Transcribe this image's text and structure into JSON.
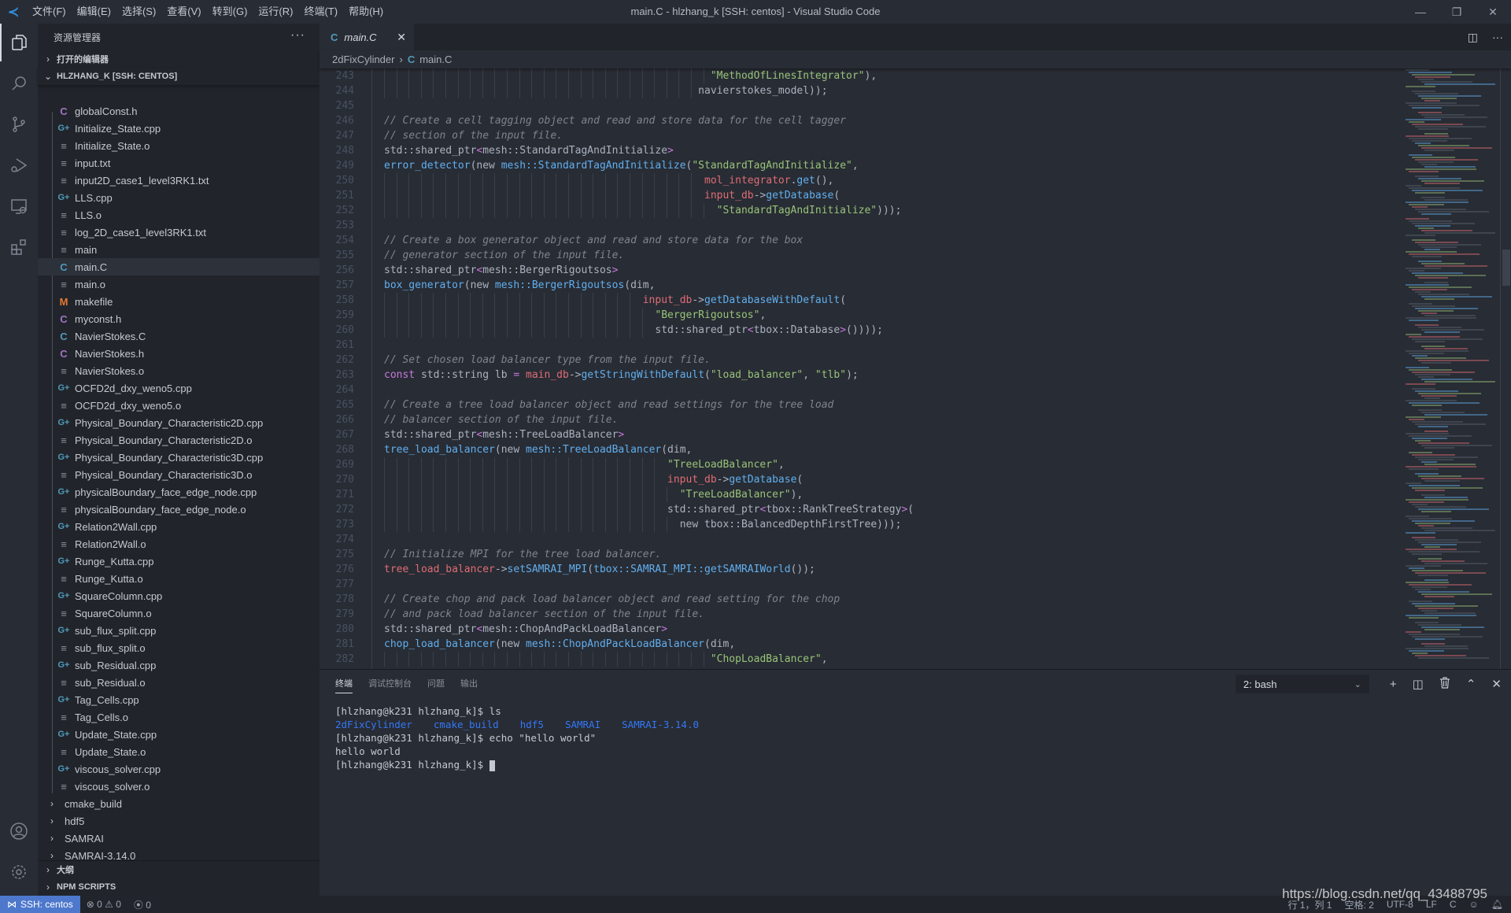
{
  "titlebar": {
    "app_icon": "vscode-logo-icon",
    "menus": [
      "文件(F)",
      "编辑(E)",
      "选择(S)",
      "查看(V)",
      "转到(G)",
      "运行(R)",
      "终端(T)",
      "帮助(H)"
    ],
    "title": "main.C - hlzhang_k [SSH: centos] - Visual Studio Code",
    "controls": {
      "minimize": "—",
      "restore": "❐",
      "close": "✕"
    }
  },
  "activitybar": {
    "items": [
      {
        "name": "explorer-icon",
        "glyph": "⧉",
        "active": true
      },
      {
        "name": "search-icon",
        "glyph": "⚲"
      },
      {
        "name": "source-control-icon",
        "glyph": "⑂"
      },
      {
        "name": "run-debug-icon",
        "glyph": "▷"
      },
      {
        "name": "remote-explorer-icon",
        "glyph": "▭"
      },
      {
        "name": "extensions-icon",
        "glyph": "⊞"
      }
    ],
    "bottom": [
      {
        "name": "account-icon",
        "glyph": "◯"
      },
      {
        "name": "settings-gear-icon",
        "glyph": "⚙"
      }
    ]
  },
  "sidebar": {
    "title": "资源管理器",
    "more": "···",
    "open_editors": "打开的编辑器",
    "workspace": "HLZHANG_K [SSH: CENTOS]",
    "files": [
      {
        "name": "globalConst.h",
        "type": "h"
      },
      {
        "name": "Initialize_State.cpp",
        "type": "cpp"
      },
      {
        "name": "Initialize_State.o",
        "type": "txt"
      },
      {
        "name": "input.txt",
        "type": "txt"
      },
      {
        "name": "input2D_case1_level3RK1.txt",
        "type": "txt"
      },
      {
        "name": "LLS.cpp",
        "type": "cpp"
      },
      {
        "name": "LLS.o",
        "type": "txt"
      },
      {
        "name": "log_2D_case1_level3RK1.txt",
        "type": "txt"
      },
      {
        "name": "main",
        "type": "txt"
      },
      {
        "name": "main.C",
        "type": "c",
        "selected": true
      },
      {
        "name": "main.o",
        "type": "txt"
      },
      {
        "name": "makefile",
        "type": "make"
      },
      {
        "name": "myconst.h",
        "type": "h"
      },
      {
        "name": "NavierStokes.C",
        "type": "c"
      },
      {
        "name": "NavierStokes.h",
        "type": "h"
      },
      {
        "name": "NavierStokes.o",
        "type": "txt"
      },
      {
        "name": "OCFD2d_dxy_weno5.cpp",
        "type": "cpp"
      },
      {
        "name": "OCFD2d_dxy_weno5.o",
        "type": "txt"
      },
      {
        "name": "Physical_Boundary_Characteristic2D.cpp",
        "type": "cpp"
      },
      {
        "name": "Physical_Boundary_Characteristic2D.o",
        "type": "txt"
      },
      {
        "name": "Physical_Boundary_Characteristic3D.cpp",
        "type": "cpp"
      },
      {
        "name": "Physical_Boundary_Characteristic3D.o",
        "type": "txt"
      },
      {
        "name": "physicalBoundary_face_edge_node.cpp",
        "type": "cpp"
      },
      {
        "name": "physicalBoundary_face_edge_node.o",
        "type": "txt"
      },
      {
        "name": "Relation2Wall.cpp",
        "type": "cpp"
      },
      {
        "name": "Relation2Wall.o",
        "type": "txt"
      },
      {
        "name": "Runge_Kutta.cpp",
        "type": "cpp"
      },
      {
        "name": "Runge_Kutta.o",
        "type": "txt"
      },
      {
        "name": "SquareColumn.cpp",
        "type": "cpp"
      },
      {
        "name": "SquareColumn.o",
        "type": "txt"
      },
      {
        "name": "sub_flux_split.cpp",
        "type": "cpp"
      },
      {
        "name": "sub_flux_split.o",
        "type": "txt"
      },
      {
        "name": "sub_Residual.cpp",
        "type": "cpp"
      },
      {
        "name": "sub_Residual.o",
        "type": "txt"
      },
      {
        "name": "Tag_Cells.cpp",
        "type": "cpp"
      },
      {
        "name": "Tag_Cells.o",
        "type": "txt"
      },
      {
        "name": "Update_State.cpp",
        "type": "cpp"
      },
      {
        "name": "Update_State.o",
        "type": "txt"
      },
      {
        "name": "viscous_solver.cpp",
        "type": "cpp"
      },
      {
        "name": "viscous_solver.o",
        "type": "txt"
      }
    ],
    "folders": [
      "cmake_build",
      "hdf5",
      "SAMRAI",
      "SAMRAI-3.14.0"
    ],
    "outline": "大纲",
    "npm_scripts": "NPM SCRIPTS"
  },
  "editor": {
    "tab": {
      "label": "main.C",
      "icon": "C",
      "close": "✕"
    },
    "actions": {
      "split": "◫",
      "more": "···"
    },
    "breadcrumb": {
      "folder": "2dFixCylinder",
      "file": "main.C",
      "icon": "C"
    },
    "code_lines": [
      {
        "n": 243,
        "indent": 53,
        "tokens": [
          [
            "st",
            "\"MethodOfLinesIntegrator\""
          ],
          [
            "ty",
            "),"
          ]
        ]
      },
      {
        "n": 244,
        "indent": 51,
        "tokens": [
          [
            "ty",
            "navierstokes_model));"
          ]
        ]
      },
      {
        "n": 245,
        "indent": 0,
        "tokens": []
      },
      {
        "n": 246,
        "indent": 0,
        "tokens": [
          [
            "cm",
            "// Create a cell tagging object and read and store data for the cell tagger"
          ]
        ]
      },
      {
        "n": 247,
        "indent": 0,
        "tokens": [
          [
            "cm",
            "// section of the input file."
          ]
        ]
      },
      {
        "n": 248,
        "indent": 0,
        "tokens": [
          [
            "ty",
            "std::shared_ptr"
          ],
          [
            "kw",
            "<"
          ],
          [
            "ty",
            "mesh::StandardTagAndInitialize"
          ],
          [
            "kw",
            ">"
          ]
        ]
      },
      {
        "n": 249,
        "indent": 0,
        "tokens": [
          [
            "fn",
            "error_detector"
          ],
          [
            "ty",
            "(new "
          ],
          [
            "fn",
            "mesh::StandardTagAndInitialize"
          ],
          [
            "ty",
            "("
          ],
          [
            "st",
            "\"StandardTagAndInitialize\""
          ],
          [
            "ty",
            ","
          ]
        ]
      },
      {
        "n": 250,
        "indent": 52,
        "tokens": [
          [
            "var",
            "mol_integrator"
          ],
          [
            "ty",
            "."
          ],
          [
            "fn",
            "get"
          ],
          [
            "ty",
            "(),"
          ]
        ]
      },
      {
        "n": 251,
        "indent": 52,
        "tokens": [
          [
            "var",
            "input_db"
          ],
          [
            "ty",
            "->"
          ],
          [
            "fn",
            "getDatabase"
          ],
          [
            "ty",
            "("
          ]
        ]
      },
      {
        "n": 252,
        "indent": 54,
        "tokens": [
          [
            "st",
            "\"StandardTagAndInitialize\""
          ],
          [
            "ty",
            ")));"
          ]
        ]
      },
      {
        "n": 253,
        "indent": 0,
        "tokens": []
      },
      {
        "n": 254,
        "indent": 0,
        "tokens": [
          [
            "cm",
            "// Create a box generator object and read and store data for the box"
          ]
        ]
      },
      {
        "n": 255,
        "indent": 0,
        "tokens": [
          [
            "cm",
            "// generator section of the input file."
          ]
        ]
      },
      {
        "n": 256,
        "indent": 0,
        "tokens": [
          [
            "ty",
            "std::shared_ptr"
          ],
          [
            "kw",
            "<"
          ],
          [
            "ty",
            "mesh::BergerRigoutsos"
          ],
          [
            "kw",
            ">"
          ]
        ]
      },
      {
        "n": 257,
        "indent": 0,
        "tokens": [
          [
            "fn",
            "box_generator"
          ],
          [
            "ty",
            "(new "
          ],
          [
            "fn",
            "mesh::BergerRigoutsos"
          ],
          [
            "ty",
            "(dim,"
          ]
        ]
      },
      {
        "n": 258,
        "indent": 42,
        "tokens": [
          [
            "var",
            "input_db"
          ],
          [
            "ty",
            "->"
          ],
          [
            "fn",
            "getDatabaseWithDefault"
          ],
          [
            "ty",
            "("
          ]
        ]
      },
      {
        "n": 259,
        "indent": 44,
        "tokens": [
          [
            "st",
            "\"BergerRigoutsos\""
          ],
          [
            "ty",
            ","
          ]
        ]
      },
      {
        "n": 260,
        "indent": 44,
        "tokens": [
          [
            "ty",
            "std::shared_ptr"
          ],
          [
            "kw",
            "<"
          ],
          [
            "ty",
            "tbox::Database"
          ],
          [
            "kw",
            ">"
          ],
          [
            "ty",
            "())));"
          ]
        ]
      },
      {
        "n": 261,
        "indent": 0,
        "tokens": []
      },
      {
        "n": 262,
        "indent": 0,
        "tokens": [
          [
            "cm",
            "// Set chosen load balancer type from the input file."
          ]
        ]
      },
      {
        "n": 263,
        "indent": 0,
        "tokens": [
          [
            "kw",
            "const"
          ],
          [
            "ty",
            " std::string lb "
          ],
          [
            "kw",
            "="
          ],
          [
            "ty",
            " "
          ],
          [
            "var",
            "main_db"
          ],
          [
            "ty",
            "->"
          ],
          [
            "fn",
            "getStringWithDefault"
          ],
          [
            "ty",
            "("
          ],
          [
            "st",
            "\"load_balancer\""
          ],
          [
            "ty",
            ", "
          ],
          [
            "st",
            "\"tlb\""
          ],
          [
            "ty",
            ");"
          ]
        ]
      },
      {
        "n": 264,
        "indent": 0,
        "tokens": []
      },
      {
        "n": 265,
        "indent": 0,
        "tokens": [
          [
            "cm",
            "// Create a tree load balancer object and read settings for the tree load"
          ]
        ]
      },
      {
        "n": 266,
        "indent": 0,
        "tokens": [
          [
            "cm",
            "// balancer section of the input file."
          ]
        ]
      },
      {
        "n": 267,
        "indent": 0,
        "tokens": [
          [
            "ty",
            "std::shared_ptr"
          ],
          [
            "kw",
            "<"
          ],
          [
            "ty",
            "mesh::TreeLoadBalancer"
          ],
          [
            "kw",
            ">"
          ]
        ]
      },
      {
        "n": 268,
        "indent": 0,
        "tokens": [
          [
            "fn",
            "tree_load_balancer"
          ],
          [
            "ty",
            "(new "
          ],
          [
            "fn",
            "mesh::TreeLoadBalancer"
          ],
          [
            "ty",
            "(dim,"
          ]
        ]
      },
      {
        "n": 269,
        "indent": 46,
        "tokens": [
          [
            "st",
            "\"TreeLoadBalancer\""
          ],
          [
            "ty",
            ","
          ]
        ]
      },
      {
        "n": 270,
        "indent": 46,
        "tokens": [
          [
            "var",
            "input_db"
          ],
          [
            "ty",
            "->"
          ],
          [
            "fn",
            "getDatabase"
          ],
          [
            "ty",
            "("
          ]
        ]
      },
      {
        "n": 271,
        "indent": 48,
        "tokens": [
          [
            "st",
            "\"TreeLoadBalancer\""
          ],
          [
            "ty",
            "),"
          ]
        ]
      },
      {
        "n": 272,
        "indent": 46,
        "tokens": [
          [
            "ty",
            "std::shared_ptr"
          ],
          [
            "kw",
            "<"
          ],
          [
            "ty",
            "tbox::RankTreeStrategy"
          ],
          [
            "kw",
            ">"
          ],
          [
            "ty",
            "("
          ]
        ]
      },
      {
        "n": 273,
        "indent": 48,
        "tokens": [
          [
            "ty",
            "new tbox::BalancedDepthFirstTree)));"
          ]
        ]
      },
      {
        "n": 274,
        "indent": 0,
        "tokens": []
      },
      {
        "n": 275,
        "indent": 0,
        "tokens": [
          [
            "cm",
            "// Initialize MPI for the tree load balancer."
          ]
        ]
      },
      {
        "n": 276,
        "indent": 0,
        "tokens": [
          [
            "var",
            "tree_load_balancer"
          ],
          [
            "ty",
            "->"
          ],
          [
            "fn",
            "setSAMRAI_MPI"
          ],
          [
            "ty",
            "("
          ],
          [
            "fn",
            "tbox::SAMRAI_MPI::getSAMRAIWorld"
          ],
          [
            "ty",
            "());"
          ]
        ]
      },
      {
        "n": 277,
        "indent": 0,
        "tokens": []
      },
      {
        "n": 278,
        "indent": 0,
        "tokens": [
          [
            "cm",
            "// Create chop and pack load balancer object and read setting for the chop"
          ]
        ]
      },
      {
        "n": 279,
        "indent": 0,
        "tokens": [
          [
            "cm",
            "// and pack load balancer section of the input file."
          ]
        ]
      },
      {
        "n": 280,
        "indent": 0,
        "tokens": [
          [
            "ty",
            "std::shared_ptr"
          ],
          [
            "kw",
            "<"
          ],
          [
            "ty",
            "mesh::ChopAndPackLoadBalancer"
          ],
          [
            "kw",
            ">"
          ]
        ]
      },
      {
        "n": 281,
        "indent": 0,
        "tokens": [
          [
            "fn",
            "chop_load_balancer"
          ],
          [
            "ty",
            "(new "
          ],
          [
            "fn",
            "mesh::ChopAndPackLoadBalancer"
          ],
          [
            "ty",
            "(dim,"
          ]
        ]
      },
      {
        "n": 282,
        "indent": 53,
        "tokens": [
          [
            "st",
            "\"ChopLoadBalancer\""
          ],
          [
            "ty",
            ","
          ]
        ]
      }
    ]
  },
  "panel": {
    "tabs": [
      "终端",
      "调试控制台",
      "问题",
      "输出"
    ],
    "active_tab": "终端",
    "terminal_select": "2: bash",
    "actions": {
      "new": "+",
      "split": "◫",
      "kill": "🗑",
      "maximize": "⌃",
      "close": "✕"
    },
    "terminal": {
      "line1": "[hlzhang@k231 hlzhang_k]$ ls",
      "ls_output": [
        "2dFixCylinder",
        "cmake_build",
        "hdf5",
        "SAMRAI",
        "SAMRAI-3.14.0"
      ],
      "line3": "[hlzhang@k231 hlzhang_k]$ echo \"hello world\"",
      "line4": "hello world",
      "prompt": "[hlzhang@k231 hlzhang_k]$ "
    }
  },
  "statusbar": {
    "remote": "SSH: centos",
    "remote_icon": "⋈",
    "errors": "⊗ 0",
    "warnings": "⚠ 0",
    "ports": "0",
    "position": "行 1，列 1",
    "spaces": "空格: 2",
    "encoding": "UTF-8",
    "eol": "LF",
    "language": "C",
    "watermark": "https://blog.csdn.net/qq_43488795"
  },
  "colors": {
    "accent": "#4d78cc",
    "background": "#282c34",
    "sidebar": "#21252b",
    "comment": "#7f848e",
    "string": "#98c379",
    "function": "#61afef",
    "variable": "#e06c75",
    "keyword": "#c678dd"
  }
}
